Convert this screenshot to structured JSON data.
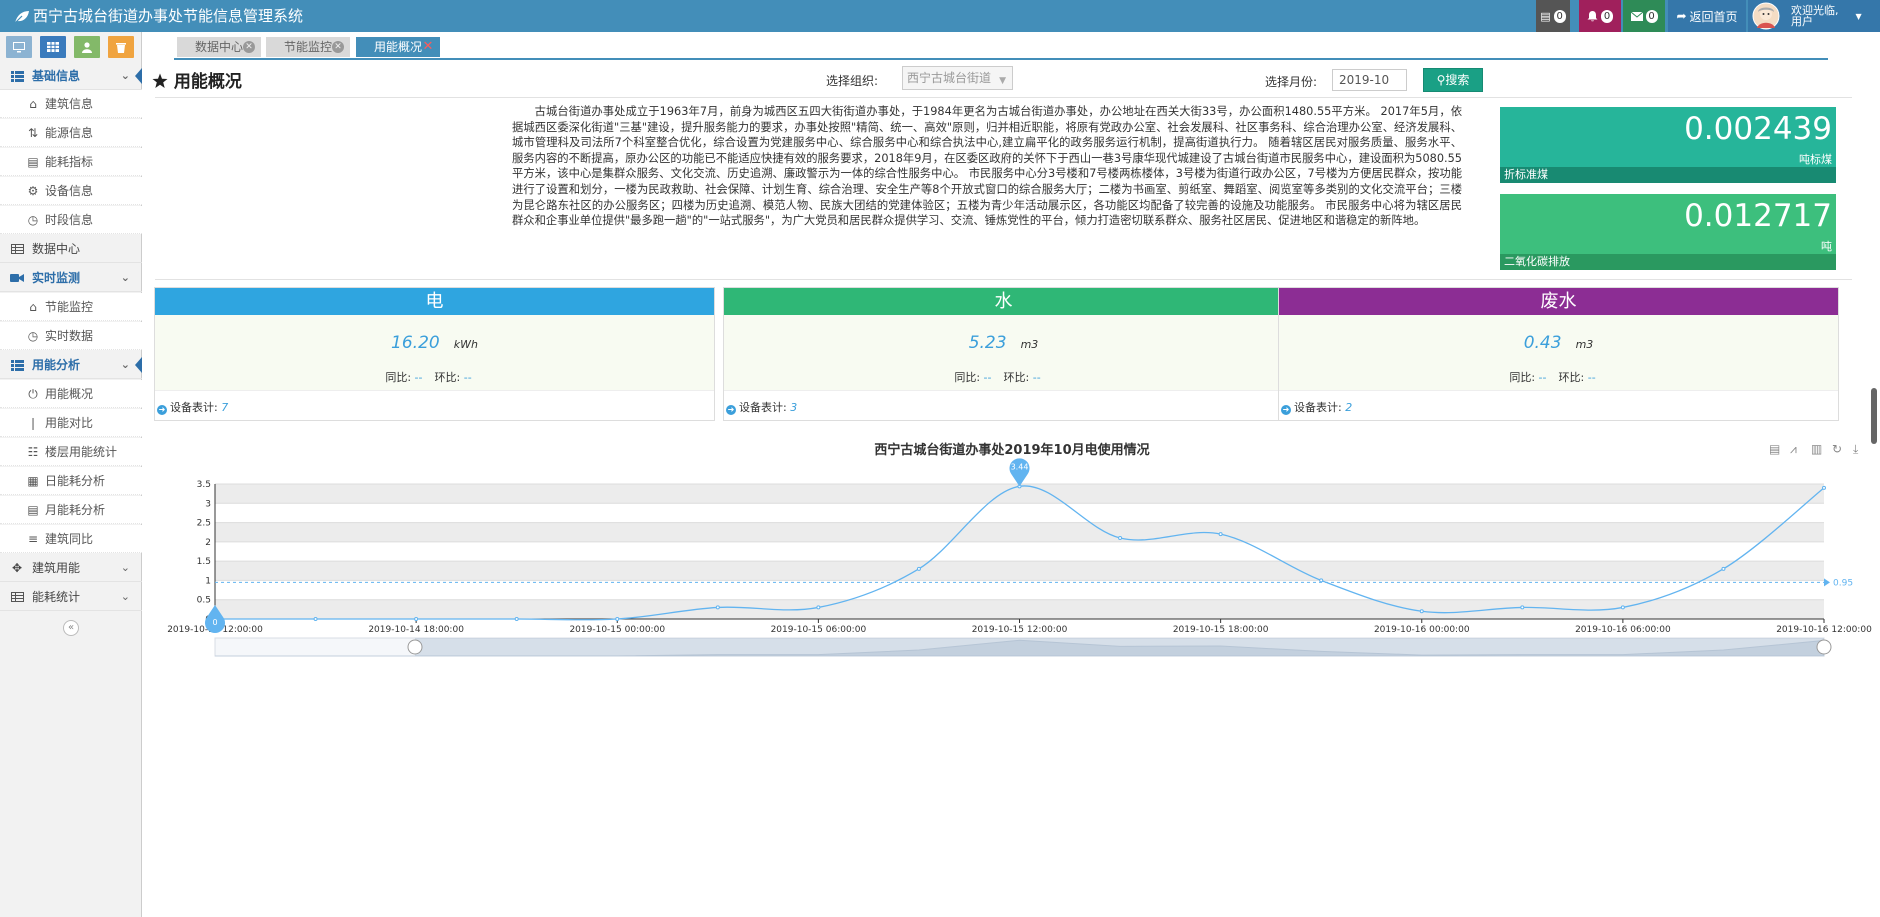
{
  "app": {
    "title": "西宁古城台街道办事处节能信息管理系统"
  },
  "topbar": {
    "tasks_count": "0",
    "notice_count": "0",
    "mail_count": "0",
    "home_label": "返回首页",
    "welcome_line1": "欢迎光临,",
    "welcome_line2": "用户"
  },
  "sidebar": {
    "shortcuts": [
      "monitor-icon",
      "table-icon",
      "user-icon",
      "trash-icon"
    ],
    "shortcut_colors": [
      "#8cb3d2",
      "#3a7bbd",
      "#83b969",
      "#f0a440"
    ],
    "groups": [
      {
        "label": "基础信息",
        "items": [
          "建筑信息",
          "能源信息",
          "能耗指标",
          "设备信息",
          "时段信息"
        ]
      },
      {
        "label": "数据中心"
      },
      {
        "label": "实时监测",
        "items": [
          "节能监控",
          "实时数据"
        ]
      },
      {
        "label": "用能分析",
        "items": [
          "用能概况",
          "用能对比",
          "楼层用能统计",
          "日能耗分析",
          "月能耗分析",
          "建筑同比"
        ]
      },
      {
        "label": "建筑用能"
      },
      {
        "label": "能耗统计"
      }
    ]
  },
  "tabs": [
    {
      "label": "数据中心"
    },
    {
      "label": "节能监控"
    },
    {
      "label": "用能概况",
      "active": true
    }
  ],
  "page": {
    "heading": "用能概况",
    "org_label": "选择组织:",
    "org_value": "西宁古城台街道",
    "month_label": "选择月份:",
    "month_value": "2019-10",
    "search_label": "搜索"
  },
  "intro": "古城台街道办事处成立于1963年7月，前身为城西区五四大街街道办事处，于1984年更名为古城台街道办事处，办公地址在西关大街33号，办公面积1480.55平方米。 2017年5月，依据城西区委深化街道\"三基\"建设，提升服务能力的要求，办事处按照\"精简、统一、高效\"原则，归并相近职能，将原有党政办公室、社会发展科、社区事务科、综合治理办公室、经济发展科、城市管理科及司法所7个科室整合优化，综合设置为党建服务中心、综合服务中心和综合执法中心,建立扁平化的政务服务运行机制，提高街道执行力。 随着辖区居民对服务质量、服务水平、服务内容的不断提高，原办公区的功能已不能适应快捷有效的服务要求，2018年9月，在区委区政府的关怀下于西山一巷3号康华现代城建设了古城台街道市民服务中心，建设面积为5080.55平方米，该中心是集群众服务、文化交流、历史追溯、廉政警示为一体的综合性服务中心。 市民服务中心分3号楼和7号楼两栋楼体，3号楼为街道行政办公区，7号楼为方便居民群众，按功能进行了设置和划分，一楼为民政救助、社会保障、计划生育、综合治理、安全生产等8个开放式窗口的综合服务大厅；二楼为书画室、剪纸室、舞蹈室、阅览室等多类别的文化交流平台；三楼为昆仑路东社区的办公服务区；四楼为历史追溯、模范人物、民族大团结的党建体验区；五楼为青少年活动展示区，各功能区均配备了较完善的设施及功能服务。 市民服务中心将为辖区居民群众和企事业单位提供\"最多跑一趟\"的\"一站式服务\"，为广大党员和居民群众提供学习、交流、锤炼党性的平台，倾力打造密切联系群众、服务社区居民、促进地区和谐稳定的新阵地。",
  "kpis": [
    {
      "value": "0.002439",
      "unit": "吨标煤",
      "name": "折标准煤",
      "color": "#26b59a",
      "bar_color": "#188a72"
    },
    {
      "value": "0.012717",
      "unit": "吨",
      "name": "二氧化碳排放",
      "color": "#3dbf7d",
      "bar_color": "#2a9960"
    }
  ],
  "cards": [
    {
      "title": "电",
      "value": "16.20",
      "unit": "kWh",
      "yoy_label": "同比:",
      "yoy": "--",
      "mom_label": "环比:",
      "mom": "--",
      "device_label": "设备表计:",
      "device_count": "7",
      "color": "#2fa5e0"
    },
    {
      "title": "水",
      "value": "5.23",
      "unit": "m3",
      "yoy_label": "同比:",
      "yoy": "--",
      "mom_label": "环比:",
      "mom": "--",
      "device_label": "设备表计:",
      "device_count": "3",
      "color": "#2fb776"
    },
    {
      "title": "废水",
      "value": "0.43",
      "unit": "m3",
      "yoy_label": "同比:",
      "yoy": "--",
      "mom_label": "环比:",
      "mom": "--",
      "device_label": "设备表计:",
      "device_count": "2",
      "color": "#8c2d94"
    }
  ],
  "chart_data": {
    "type": "line",
    "title": "西宁古城台街道办事处2019年10月电使用情况",
    "x": [
      "2019-10-14 12:00:00",
      "2019-10-14 15:00:00",
      "2019-10-14 18:00:00",
      "2019-10-14 21:00:00",
      "2019-10-15 00:00:00",
      "2019-10-15 03:00:00",
      "2019-10-15 06:00:00",
      "2019-10-15 09:00:00",
      "2019-10-15 12:00:00",
      "2019-10-15 15:00:00",
      "2019-10-15 18:00:00",
      "2019-10-15 21:00:00",
      "2019-10-16 00:00:00",
      "2019-10-16 03:00:00",
      "2019-10-16 06:00:00",
      "2019-10-16 09:00:00",
      "2019-10-16 12:00:00"
    ],
    "xticks": [
      "2019-10-14 12:00:00",
      "2019-10-14 18:00:00",
      "2019-10-15 00:00:00",
      "2019-10-15 06:00:00",
      "2019-10-15 12:00:00",
      "2019-10-15 18:00:00",
      "2019-10-16 00:00:00",
      "2019-10-16 06:00:00",
      "2019-10-16 12:00:00"
    ],
    "values": [
      0,
      0,
      0,
      0,
      0,
      0.3,
      0.3,
      1.3,
      3.44,
      2.1,
      2.2,
      1.0,
      0.2,
      0.3,
      0.3,
      1.3,
      3.4
    ],
    "yticks": [
      "0",
      "0.5",
      "1",
      "1.5",
      "2",
      "2.5",
      "3",
      "3.5"
    ],
    "ylim": [
      0,
      3.5
    ],
    "max_label": "3.44",
    "min_label": "0",
    "mean_value": 0.95,
    "mean_label": "0.95",
    "grid": true,
    "series_color": "#62b4f0",
    "toolbox": [
      "data-view-icon",
      "line-icon",
      "bar-icon",
      "restore-icon",
      "download-icon"
    ]
  }
}
